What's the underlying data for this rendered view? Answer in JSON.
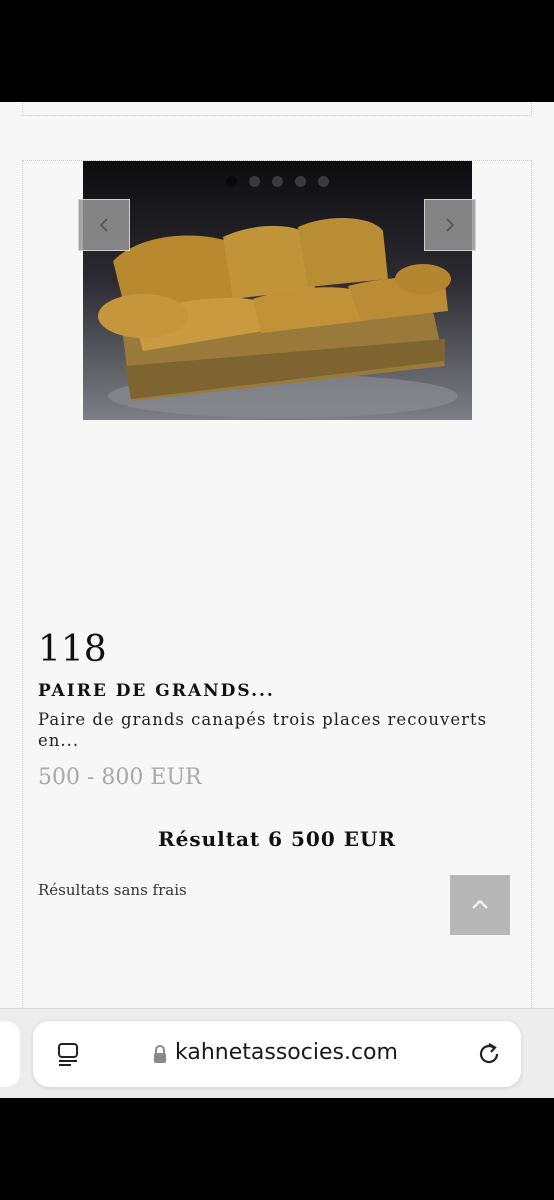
{
  "lot": {
    "number": "118",
    "title": "PAIRE DE GRANDS...",
    "description": "Paire de grands canapés trois places recouverts en...",
    "estimate": "500 - 800 EUR",
    "result": "Résultat 6 500 EUR",
    "fees_note": "Résultats sans frais"
  },
  "carousel": {
    "slide_count": 5,
    "active_index": 0,
    "prev_icon": "chevron-left-icon",
    "next_icon": "chevron-right-icon"
  },
  "scroll_top": {
    "icon": "chevron-up-icon"
  },
  "browser": {
    "url": "kahnetassocies.com",
    "reader_icon": "reader-mode-icon",
    "lock_icon": "lock-icon",
    "reload_icon": "reload-icon"
  }
}
